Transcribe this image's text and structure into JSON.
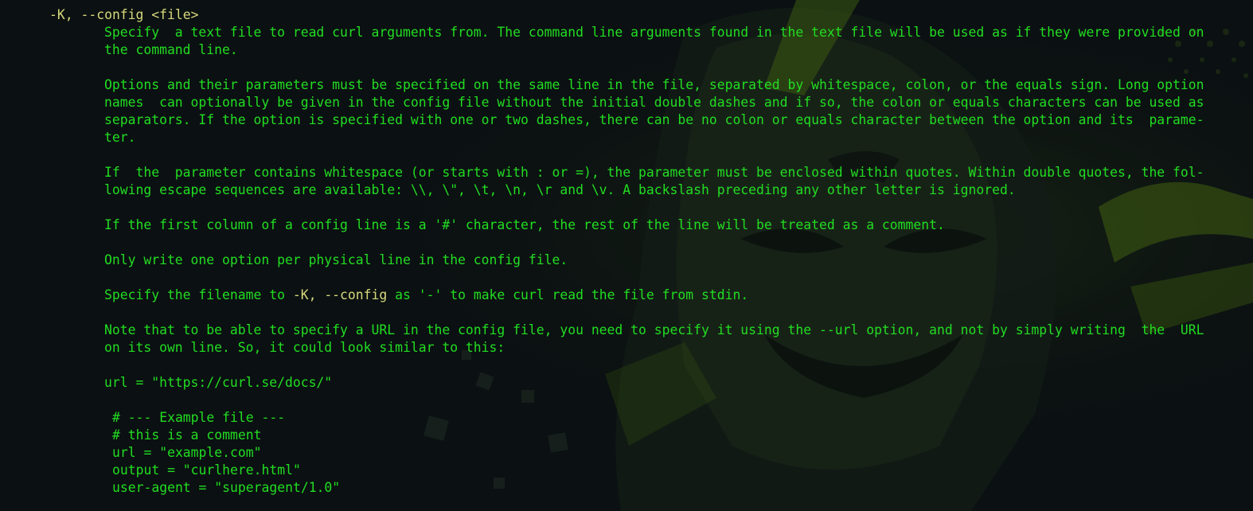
{
  "terminal": {
    "colors": {
      "background": "#0b1012",
      "text_green": "#22dd22",
      "text_bold": "#d6d97a"
    },
    "wallpaper": "hacker-mask-wallpaper",
    "lines": [
      "-K, --config <file>",
      "Specify  a text file to read curl arguments from. The command line arguments found in the text file will be used as if they were provided on",
      "the command line.",
      "Options and their parameters must be specified on the same line in the file, separated by whitespace, colon, or the equals sign. Long option",
      "names  can optionally be given in the config file without the initial double dashes and if so, the colon or equals characters can be used as",
      "separators. If the option is specified with one or two dashes, there can be no colon or equals character between the option and its  parame-",
      "ter.",
      "If  the  parameter contains whitespace (or starts with : or =), the parameter must be enclosed within quotes. Within double quotes, the fol-",
      "lowing escape sequences are available: \\\\, \\\", \\t, \\n, \\r and \\v. A backslash preceding any other letter is ignored.",
      "If the first column of a config line is a '#' character, the rest of the line will be treated as a comment.",
      "Only write one option per physical line in the config file.",
      "Specify the filename to",
      "-K, --config",
      "as '-' to make curl read the file from stdin.",
      "Note that to be able to specify a URL in the config file, you need to specify it using the --url option, and not by simply writing  the  URL",
      "on its own line. So, it could look similar to this:",
      "url = \"https://curl.se/docs/\"",
      "# --- Example file ---",
      "# this is a comment",
      "url = \"example.com\"",
      "output = \"curlhere.html\"",
      "user-agent = \"superagent/1.0\""
    ]
  }
}
